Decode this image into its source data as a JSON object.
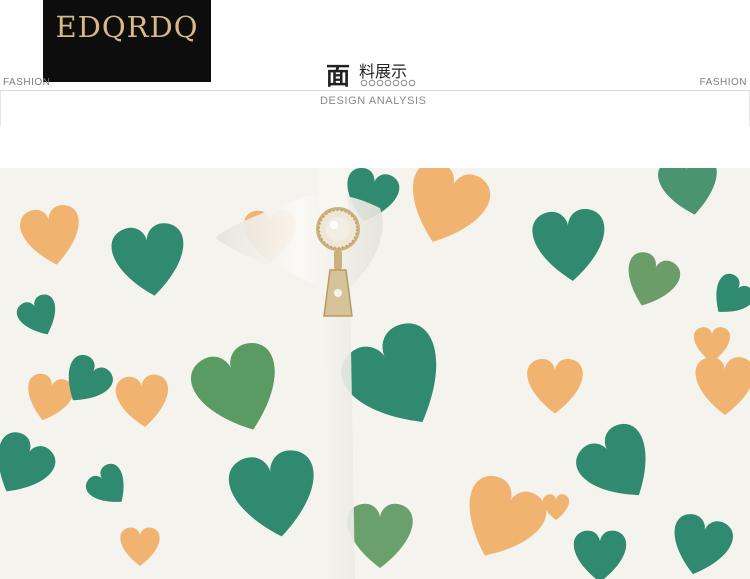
{
  "header": {
    "logo_text": "EDQRDQ",
    "fashion_left": "FASHION",
    "fashion_right": "FASHION",
    "title_first_char": "面",
    "title_rest": "料展示",
    "subtitle": "DESIGN ANALYSIS"
  },
  "photo": {
    "subject": "fabric-closeup",
    "colors": {
      "background": "#f4f3ee",
      "heart_green": "#2f8a6f",
      "heart_orange": "#f1b470",
      "pearl": "#f3eee4",
      "gold": "#cdb07a"
    }
  }
}
